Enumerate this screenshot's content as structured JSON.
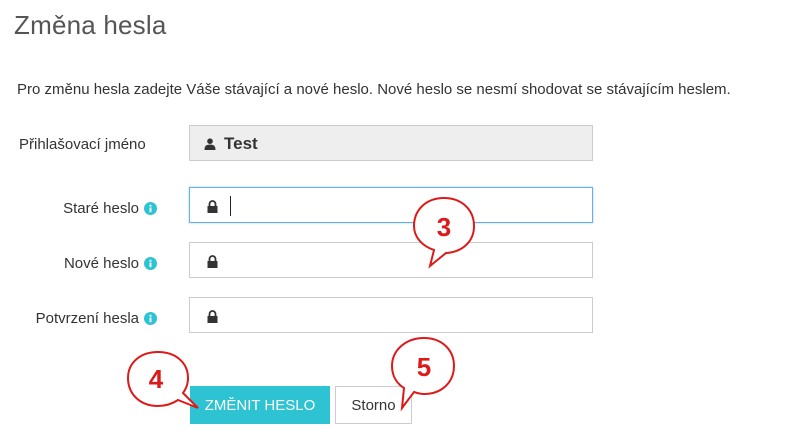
{
  "page": {
    "title": "Změna hesla",
    "intro": "Pro změnu hesla zadejte Váše stávající a nové heslo. Nové heslo se nesmí shodovat se stávajícím heslem."
  },
  "form": {
    "login": {
      "label": "Přihlašovací jméno",
      "value": "Test",
      "icon": "user-icon"
    },
    "old_password": {
      "label": "Staré heslo",
      "value": "",
      "icon": "lock-icon",
      "info_icon": "info-icon"
    },
    "new_password": {
      "label": "Nové heslo",
      "value": "",
      "icon": "lock-icon",
      "info_icon": "info-icon"
    },
    "confirm_password": {
      "label": "Potvrzení hesla",
      "value": "",
      "icon": "lock-icon",
      "info_icon": "info-icon"
    }
  },
  "buttons": {
    "submit_label": "ZMĚNIT HESLO",
    "cancel_label": "Storno"
  },
  "annotations": {
    "callout_3": "3",
    "callout_4": "4",
    "callout_5": "5"
  },
  "colors": {
    "primary": "#2ec3d3",
    "info": "#2ec3d3",
    "callout": "#dd1a1a",
    "focus_border": "#66afe9"
  }
}
